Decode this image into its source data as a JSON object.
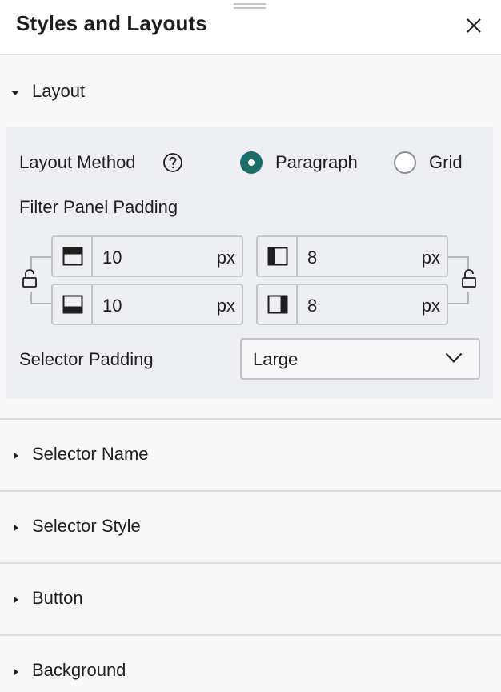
{
  "header": {
    "title": "Styles and Layouts"
  },
  "layout": {
    "label": "Layout",
    "layout_method": {
      "label": "Layout Method",
      "options": [
        {
          "label": "Paragraph",
          "selected": true
        },
        {
          "label": "Grid",
          "selected": false
        }
      ]
    },
    "filter_panel_padding": {
      "label": "Filter Panel Padding",
      "top": {
        "value": "10",
        "unit": "px"
      },
      "bottom": {
        "value": "10",
        "unit": "px"
      },
      "left": {
        "value": "8",
        "unit": "px"
      },
      "right": {
        "value": "8",
        "unit": "px"
      }
    },
    "selector_padding": {
      "label": "Selector Padding",
      "value": "Large"
    }
  },
  "sections": [
    {
      "label": "Selector Name"
    },
    {
      "label": "Selector Style"
    },
    {
      "label": "Button"
    },
    {
      "label": "Background"
    }
  ],
  "colors": {
    "accent": "#1b6d6a",
    "border": "#c3c4c7",
    "panel_bg": "#eeeff3"
  }
}
